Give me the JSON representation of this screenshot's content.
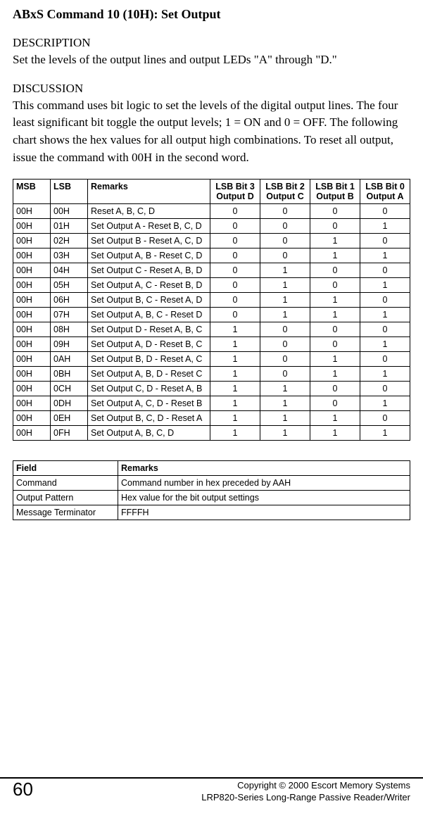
{
  "title": "ABxS Command 10 (10H): Set Output",
  "description": {
    "heading": "DESCRIPTION",
    "text": "Set the levels of the output lines and output LEDs \"A\" through \"D.\""
  },
  "discussion": {
    "heading": "DISCUSSION",
    "text": "This command uses bit logic to set the levels of the digital output lines. The four least significant bit toggle the output levels; 1 = ON and 0 = OFF. The following chart shows the hex values for all output high combinations. To reset all output, issue the command with 00H in the second word."
  },
  "table1": {
    "headers": {
      "msb": "MSB",
      "lsb": "LSB",
      "remarks": "Remarks",
      "bit3a": "LSB Bit 3",
      "bit3b": "Output D",
      "bit2a": "LSB Bit 2",
      "bit2b": "Output C",
      "bit1a": "LSB Bit 1",
      "bit1b": "Output B",
      "bit0a": "LSB Bit 0",
      "bit0b": "Output A"
    },
    "rows": [
      {
        "msb": "00H",
        "lsb": "00H",
        "remarks": "Reset A, B, C, D",
        "b3": "0",
        "b2": "0",
        "b1": "0",
        "b0": "0"
      },
      {
        "msb": "00H",
        "lsb": "01H",
        "remarks": "Set Output A - Reset B, C, D",
        "b3": "0",
        "b2": "0",
        "b1": "0",
        "b0": "1"
      },
      {
        "msb": "00H",
        "lsb": "02H",
        "remarks": "Set Output B - Reset A, C, D",
        "b3": "0",
        "b2": "0",
        "b1": "1",
        "b0": "0"
      },
      {
        "msb": "00H",
        "lsb": "03H",
        "remarks": "Set Output A, B - Reset C, D",
        "b3": "0",
        "b2": "0",
        "b1": "1",
        "b0": "1"
      },
      {
        "msb": "00H",
        "lsb": "04H",
        "remarks": "Set Output C - Reset A, B, D",
        "b3": "0",
        "b2": "1",
        "b1": "0",
        "b0": "0"
      },
      {
        "msb": "00H",
        "lsb": "05H",
        "remarks": "Set Output A, C - Reset B, D",
        "b3": "0",
        "b2": "1",
        "b1": "0",
        "b0": "1"
      },
      {
        "msb": "00H",
        "lsb": "06H",
        "remarks": "Set Output B, C - Reset A, D",
        "b3": "0",
        "b2": "1",
        "b1": "1",
        "b0": "0"
      },
      {
        "msb": "00H",
        "lsb": "07H",
        "remarks": "Set Output A, B, C - Reset D",
        "b3": "0",
        "b2": "1",
        "b1": "1",
        "b0": "1"
      },
      {
        "msb": "00H",
        "lsb": "08H",
        "remarks": "Set Output D - Reset A, B, C",
        "b3": "1",
        "b2": "0",
        "b1": "0",
        "b0": "0"
      },
      {
        "msb": "00H",
        "lsb": "09H",
        "remarks": "Set Output A, D - Reset B, C",
        "b3": "1",
        "b2": "0",
        "b1": "0",
        "b0": "1"
      },
      {
        "msb": "00H",
        "lsb": "0AH",
        "remarks": "Set Output B, D - Reset A, C",
        "b3": "1",
        "b2": "0",
        "b1": "1",
        "b0": "0"
      },
      {
        "msb": "00H",
        "lsb": "0BH",
        "remarks": "Set Output A, B, D - Reset C",
        "b3": "1",
        "b2": "0",
        "b1": "1",
        "b0": "1"
      },
      {
        "msb": "00H",
        "lsb": "0CH",
        "remarks": "Set Output C, D  - Reset A, B",
        "b3": "1",
        "b2": "1",
        "b1": "0",
        "b0": "0"
      },
      {
        "msb": "00H",
        "lsb": "0DH",
        "remarks": "Set Output A, C, D - Reset B",
        "b3": "1",
        "b2": "1",
        "b1": "0",
        "b0": "1"
      },
      {
        "msb": "00H",
        "lsb": "0EH",
        "remarks": "Set Output B, C, D - Reset A",
        "b3": "1",
        "b2": "1",
        "b1": "1",
        "b0": "0"
      },
      {
        "msb": "00H",
        "lsb": "0FH",
        "remarks": "Set Output A, B, C, D",
        "b3": "1",
        "b2": "1",
        "b1": "1",
        "b0": "1"
      }
    ]
  },
  "table2": {
    "headers": {
      "field": "Field",
      "remarks": "Remarks"
    },
    "rows": [
      {
        "field": "Command",
        "remarks": "Command number in hex preceded by AAH"
      },
      {
        "field": "Output Pattern",
        "remarks": "Hex value for the bit output settings"
      },
      {
        "field": "Message Terminator",
        "remarks": "FFFFH"
      }
    ]
  },
  "footer": {
    "page": "60",
    "line1": "Copyright © 2000 Escort Memory Systems",
    "line2": "LRP820-Series Long-Range Passive Reader/Writer"
  }
}
